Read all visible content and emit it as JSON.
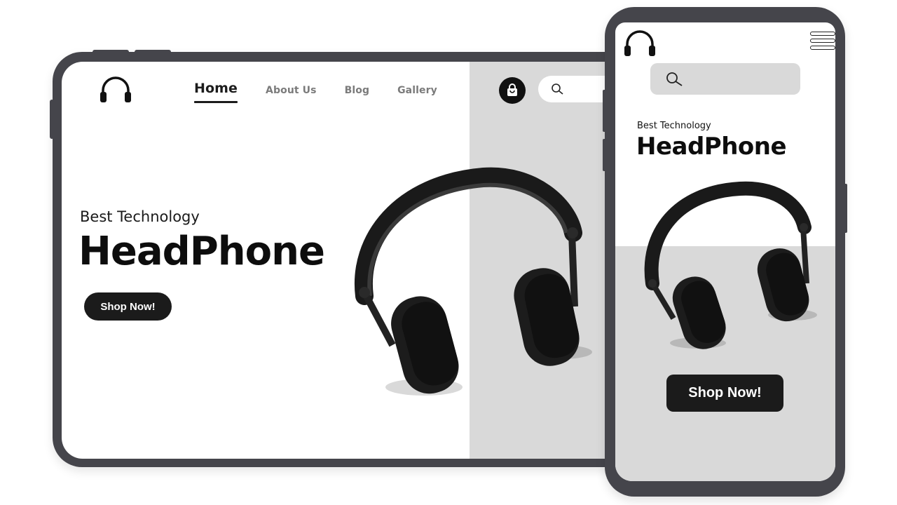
{
  "tablet": {
    "nav": [
      "Home",
      "About Us",
      "Blog",
      "Gallery"
    ],
    "active_nav": "Home",
    "search_placeholder": "",
    "hero": {
      "subtitle": "Best Technology",
      "title": "HeadPhone",
      "cta": "Shop Now!"
    }
  },
  "phone": {
    "search_placeholder": "",
    "hero": {
      "subtitle": "Best Technology",
      "title": "HeadPhone",
      "cta": "Shop Now!"
    }
  },
  "icons": {
    "logo": "headphones-icon",
    "cart": "shopping-bag-icon",
    "search": "search-icon",
    "menu": "hamburger-menu-icon"
  },
  "colors": {
    "frame": "#45454b",
    "panel": "#d9d9d9",
    "button": "#1b1b1b",
    "text": "#0d0d0d"
  }
}
